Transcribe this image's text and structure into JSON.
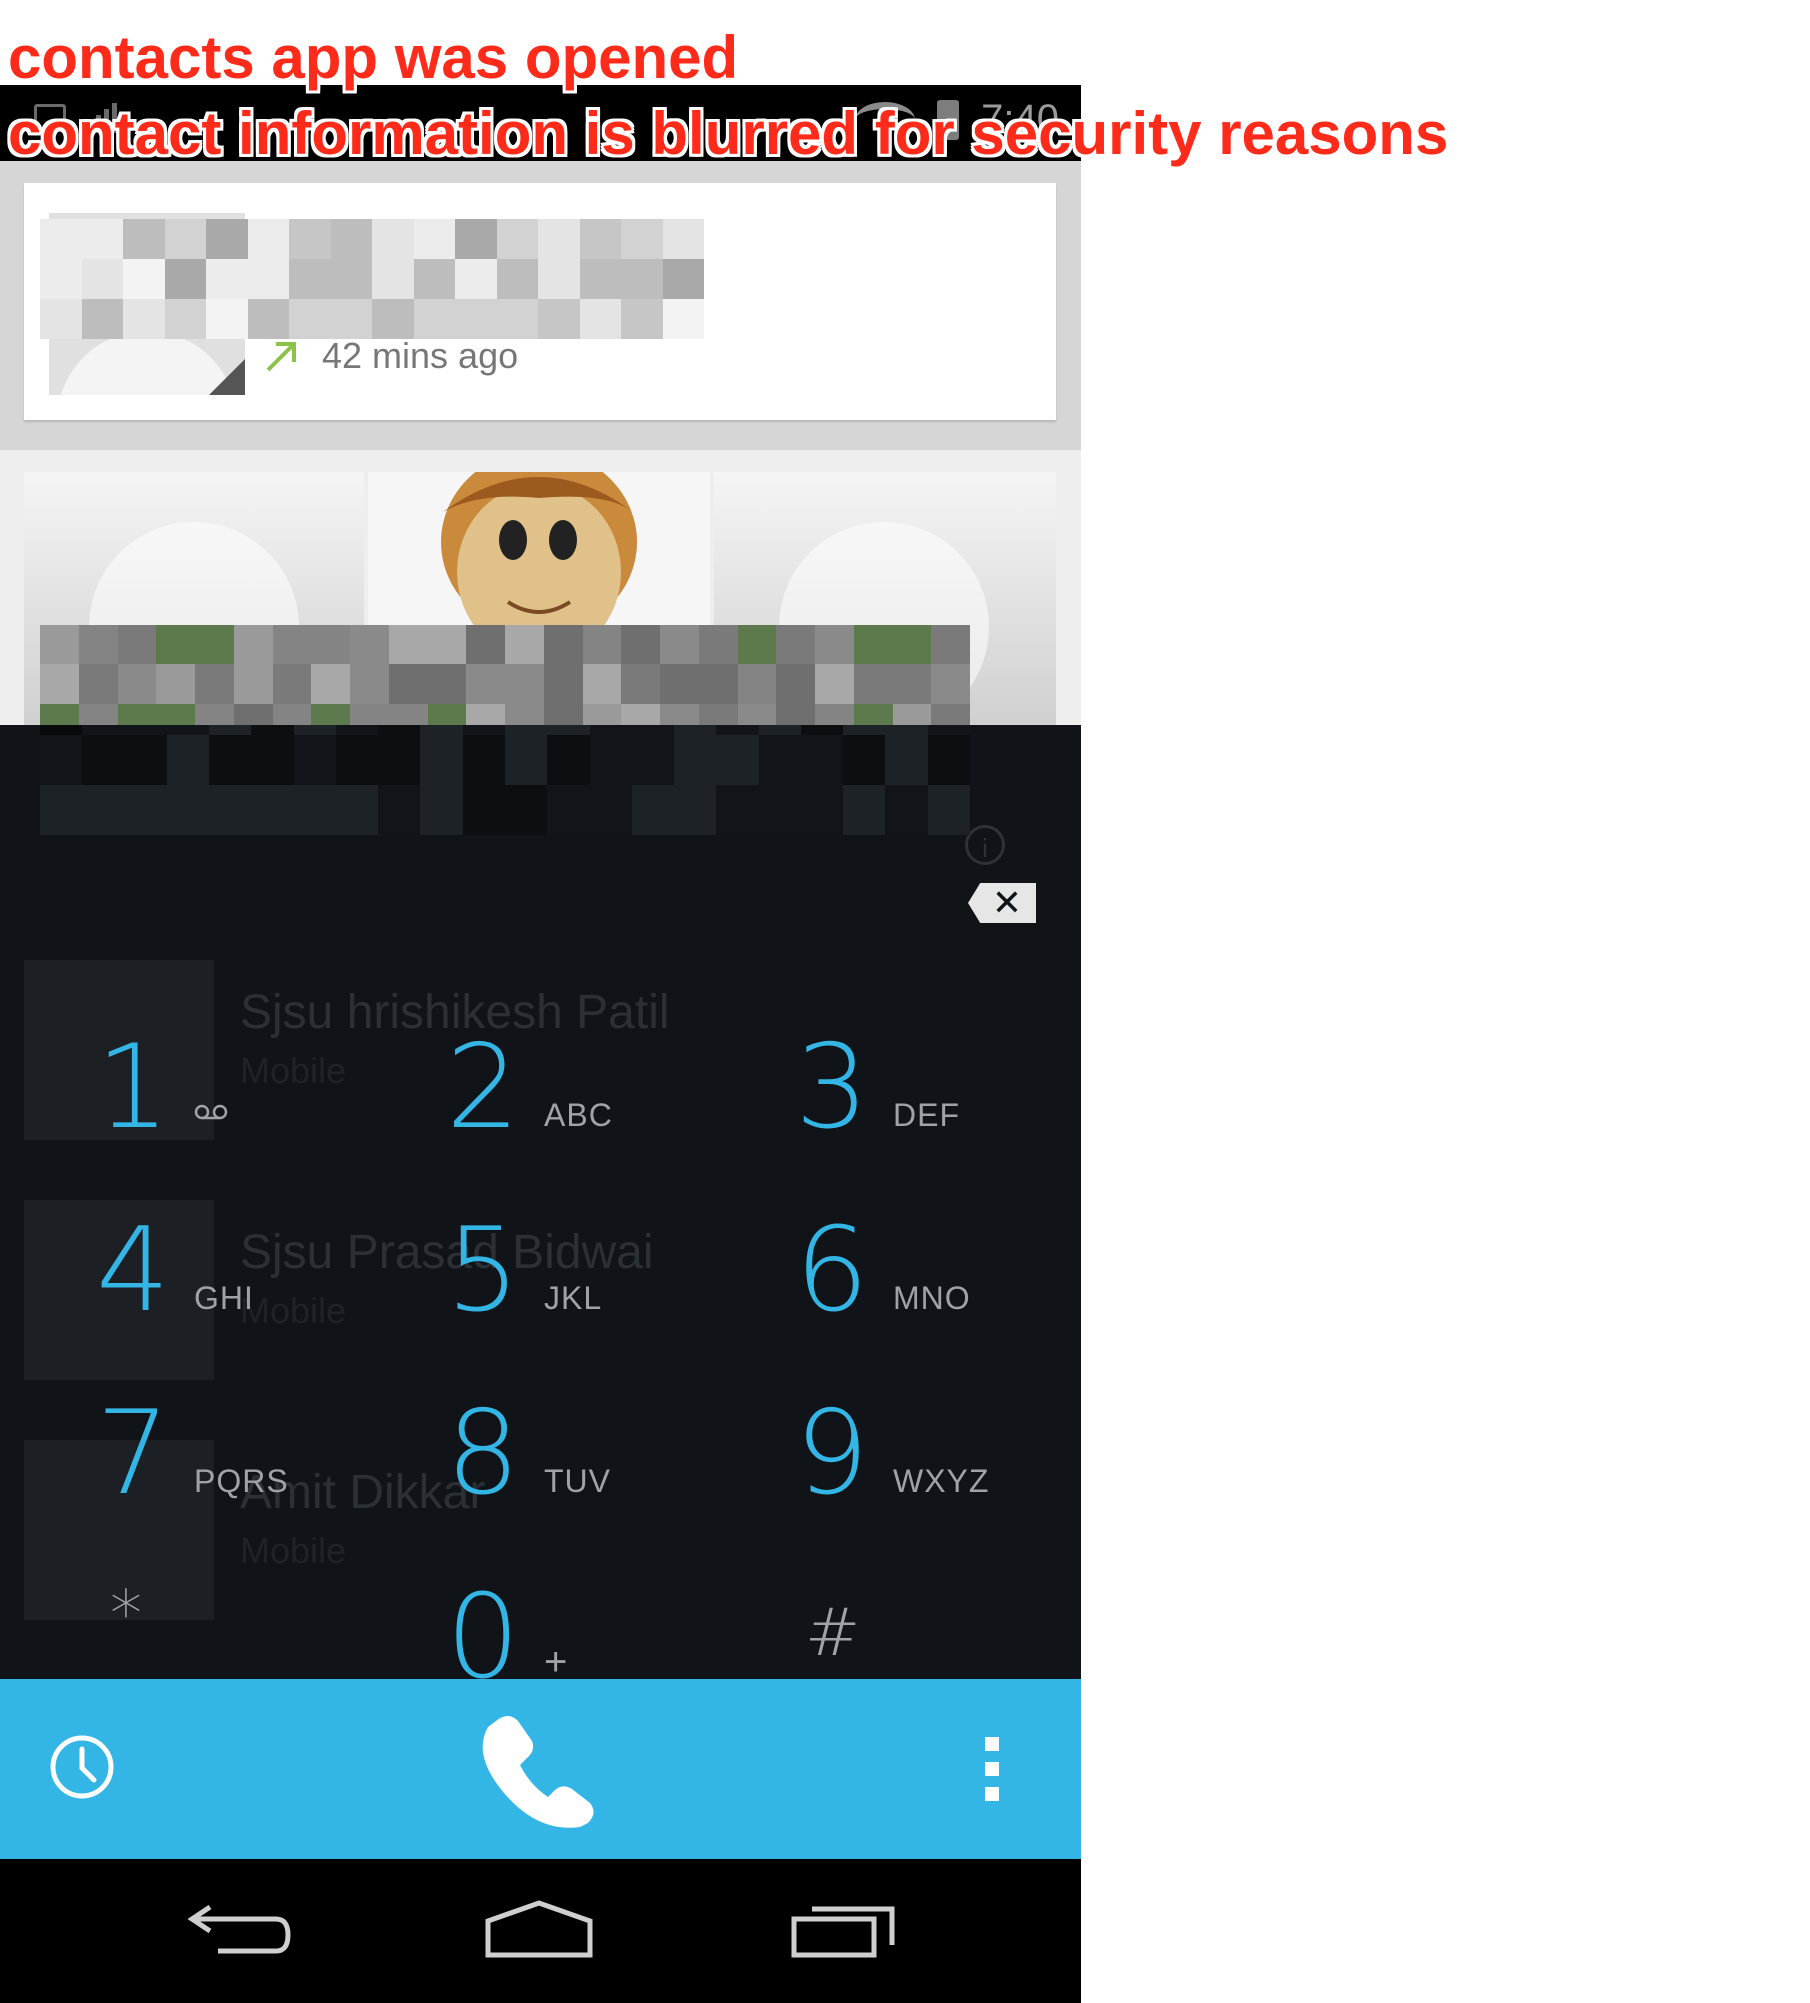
{
  "annotations": {
    "line1": "contacts app was opened",
    "line2": "contact information is blurred for security reasons"
  },
  "status_bar": {
    "time": "7:40"
  },
  "recent_call": {
    "direction_icon": "outgoing-call-arrow-icon",
    "time_ago": "42 mins ago"
  },
  "favorites": {
    "count": 3
  },
  "search_results": [
    {
      "name": "Sjsu hrishikesh Patil",
      "type": "Mobile"
    },
    {
      "name": "Sjsu Prasad Bidwai",
      "type": "Mobile"
    },
    {
      "name": "Amit Dikkar",
      "type": "Mobile"
    }
  ],
  "dialpad": {
    "keys": [
      {
        "digit": "1",
        "letters": ""
      },
      {
        "digit": "2",
        "letters": "ABC"
      },
      {
        "digit": "3",
        "letters": "DEF"
      },
      {
        "digit": "4",
        "letters": "GHI"
      },
      {
        "digit": "5",
        "letters": "JKL"
      },
      {
        "digit": "6",
        "letters": "MNO"
      },
      {
        "digit": "7",
        "letters": "PQRS"
      },
      {
        "digit": "8",
        "letters": "TUV"
      },
      {
        "digit": "9",
        "letters": "WXYZ"
      },
      {
        "digit": "*",
        "letters": ""
      },
      {
        "digit": "0",
        "letters": "+"
      },
      {
        "digit": "#",
        "letters": ""
      }
    ]
  },
  "colors": {
    "accent": "#33b5e5",
    "dialer_background": "#101418",
    "annotation": "#ff2b1a"
  },
  "icons": {
    "action_bar": [
      "call-history-icon",
      "phone-call-icon",
      "overflow-menu-icon"
    ],
    "nav_bar": [
      "back-icon",
      "home-icon",
      "recents-icon"
    ]
  }
}
